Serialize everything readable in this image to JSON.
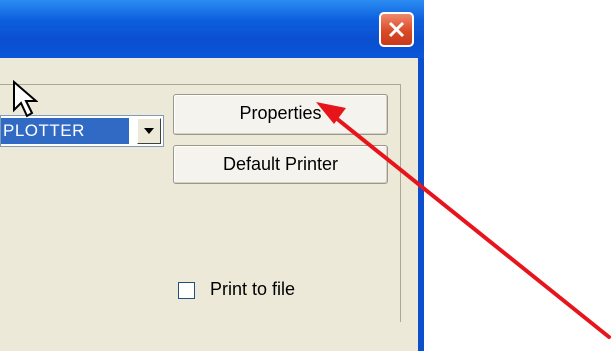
{
  "window": {
    "close_icon": "close-icon",
    "accent_color": "#0a4fd0",
    "close_color": "#d94a28"
  },
  "printer": {
    "selected_name": "PLOTTER",
    "dropdown_icon": "chevron-down-icon"
  },
  "buttons": {
    "properties_label": "Properties",
    "default_printer_label": "Default Printer"
  },
  "print_to_file": {
    "label": "Print to file",
    "checked": false
  },
  "annotation": {
    "arrow_color": "#e8141c",
    "cursor_icon": "mouse-pointer-icon"
  }
}
